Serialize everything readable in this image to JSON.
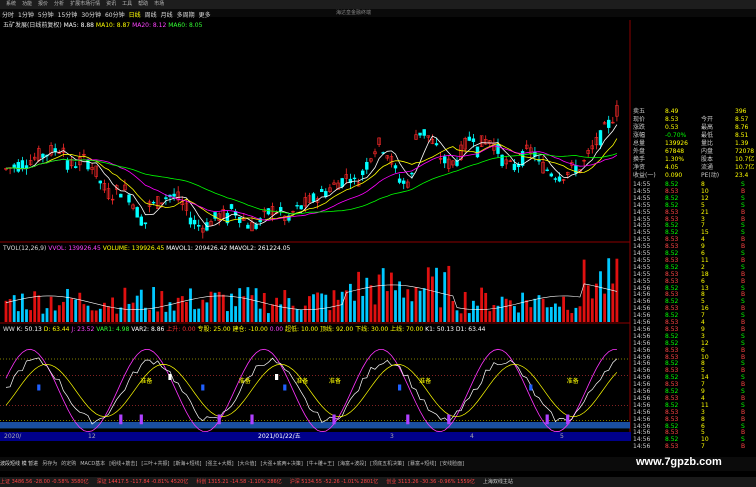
{
  "menu": [
    "系统",
    "功能",
    "报价",
    "分析",
    "扩展市场行情",
    "资讯",
    "工具",
    "帮助",
    "市场"
  ],
  "window_title": "海达皇金融终端",
  "periods": [
    "分时",
    "1分钟",
    "5分钟",
    "15分钟",
    "30分钟",
    "60分钟",
    "日线",
    "周线",
    "月线",
    "多周期",
    "更多"
  ],
  "stock_name": "五矿发展(日线前复权)",
  "ma": {
    "ma5": "MA5: 8.88",
    "ma10": "MA10: 8.87",
    "ma20": "MA20: 8.12",
    "ma60": "MA60: 8.05"
  },
  "vol": {
    "name": "TVOL(12,26,9)",
    "vvol": "VVOL: 139926.45",
    "volume": "VOLUME: 139926.45",
    "mavol1": "MAVOL1: 209426.42",
    "mavol2": "MAVOL2: 261224.05"
  },
  "ww": {
    "name": "WW",
    "k": "K: 50.13",
    "d": "D: 63.44",
    "j": "J: 23.52",
    "var1": "VAR1: 4.98",
    "var2": "VAR2: 8.86",
    "extra1": "上升: 0.00",
    "extra2": "专股: 25.00",
    "extra3": "建仓: -10.00",
    "extra4": "0.00",
    "extra5": "超低: 10.00",
    "extra6": "顶线: 92.00",
    "extra7": "下线: 30.00",
    "extra8": "上线: 70.00",
    "k1": "K1: 50.13",
    "d1": "D1: 63.44"
  },
  "labels": {
    "zhunbei": "准备",
    "cross": "十",
    "top": "顶"
  },
  "price_axis": [
    "8.50",
    "8.00",
    "7.50",
    "7.00",
    "6.50"
  ],
  "vol_axis": [
    "46562",
    "30000",
    "20000",
    "10000",
    "X10"
  ],
  "ww_axis": [
    "120.00",
    "100.00",
    "80.00",
    "60.00",
    "40.00",
    "20.00",
    "0.00"
  ],
  "dates": [
    "2020/",
    "12",
    "2021/01/22/五",
    "3",
    "4",
    "5"
  ],
  "quote": {
    "rows": [
      {
        "l": "卖五",
        "v": "8.49",
        "r": "",
        "rv": "396"
      },
      {
        "l": "现价",
        "v": "8.53",
        "r": "今开",
        "rv": "8.57"
      },
      {
        "l": "涨跌",
        "v": "0.53",
        "r": "最高",
        "rv": "8.76"
      },
      {
        "l": "涨幅",
        "v": "-0.70%",
        "r": "最低",
        "rv": "8.51"
      },
      {
        "l": "总量",
        "v": "139926",
        "r": "量比",
        "rv": "1.39"
      },
      {
        "l": "外盘",
        "v": "67848",
        "r": "内盘",
        "rv": "72078"
      },
      {
        "l": "换手",
        "v": "1.30%",
        "r": "股本",
        "rv": "10.7亿"
      },
      {
        "l": "净资",
        "v": "4.05",
        "r": "流通",
        "rv": "10.7亿"
      },
      {
        "l": "收益(一)",
        "v": "0.090",
        "r": "PE(动)",
        "rv": "23.4"
      }
    ],
    "ticks": [
      {
        "t": "14:55",
        "p": "8.52",
        "v": "8",
        "d": "S"
      },
      {
        "t": "14:55",
        "p": "8.53",
        "v": "10",
        "d": "B"
      },
      {
        "t": "14:55",
        "p": "8.52",
        "v": "12",
        "d": "S"
      },
      {
        "t": "14:55",
        "p": "8.52",
        "v": "5",
        "d": "S"
      },
      {
        "t": "14:55",
        "p": "8.53",
        "v": "21",
        "d": "B"
      },
      {
        "t": "14:55",
        "p": "8.53",
        "v": "3",
        "d": "B"
      },
      {
        "t": "14:55",
        "p": "8.52",
        "v": "7",
        "d": "S"
      },
      {
        "t": "14:55",
        "p": "8.52",
        "v": "15",
        "d": "S"
      },
      {
        "t": "14:55",
        "p": "8.53",
        "v": "4",
        "d": "B"
      },
      {
        "t": "14:55",
        "p": "8.53",
        "v": "9",
        "d": "B"
      },
      {
        "t": "14:55",
        "p": "8.52",
        "v": "6",
        "d": "S"
      },
      {
        "t": "14:55",
        "p": "8.53",
        "v": "11",
        "d": "B"
      },
      {
        "t": "14:55",
        "p": "8.52",
        "v": "2",
        "d": "S"
      },
      {
        "t": "14:55",
        "p": "8.53",
        "v": "18",
        "d": "B"
      },
      {
        "t": "14:55",
        "p": "8.53",
        "v": "6",
        "d": "B"
      },
      {
        "t": "14:56",
        "p": "8.52",
        "v": "13",
        "d": "S"
      },
      {
        "t": "14:56",
        "p": "8.53",
        "v": "8",
        "d": "B"
      },
      {
        "t": "14:56",
        "p": "8.52",
        "v": "5",
        "d": "S"
      },
      {
        "t": "14:56",
        "p": "8.53",
        "v": "16",
        "d": "B"
      },
      {
        "t": "14:56",
        "p": "8.52",
        "v": "7",
        "d": "S"
      },
      {
        "t": "14:56",
        "p": "8.53",
        "v": "4",
        "d": "B"
      },
      {
        "t": "14:56",
        "p": "8.53",
        "v": "9",
        "d": "B"
      },
      {
        "t": "14:56",
        "p": "8.52",
        "v": "3",
        "d": "S"
      },
      {
        "t": "14:56",
        "p": "8.52",
        "v": "12",
        "d": "S"
      },
      {
        "t": "14:56",
        "p": "8.53",
        "v": "6",
        "d": "B"
      },
      {
        "t": "14:56",
        "p": "8.53",
        "v": "10",
        "d": "B"
      },
      {
        "t": "14:56",
        "p": "8.52",
        "v": "8",
        "d": "S"
      },
      {
        "t": "14:56",
        "p": "8.53",
        "v": "5",
        "d": "B"
      },
      {
        "t": "14:56",
        "p": "8.52",
        "v": "14",
        "d": "S"
      },
      {
        "t": "14:56",
        "p": "8.53",
        "v": "7",
        "d": "B"
      },
      {
        "t": "14:56",
        "p": "8.52",
        "v": "9",
        "d": "S"
      },
      {
        "t": "14:56",
        "p": "8.53",
        "v": "4",
        "d": "B"
      },
      {
        "t": "14:56",
        "p": "8.52",
        "v": "11",
        "d": "S"
      },
      {
        "t": "14:56",
        "p": "8.53",
        "v": "3",
        "d": "B"
      },
      {
        "t": "14:56",
        "p": "8.53",
        "v": "8",
        "d": "B"
      },
      {
        "t": "14:56",
        "p": "8.52",
        "v": "6",
        "d": "S"
      },
      {
        "t": "14:56",
        "p": "8.53",
        "v": "5",
        "d": "B"
      },
      {
        "t": "14:56",
        "p": "8.52",
        "v": "10",
        "d": "S"
      },
      {
        "t": "14:56",
        "p": "8.53",
        "v": "7",
        "d": "B"
      }
    ]
  },
  "tabs": [
    "波段短线 模 暂进",
    "另存为",
    "的定购",
    "MACD基本",
    "[组线+筋击]",
    "[三叶+共振]",
    "[斯海+短线]",
    "[强主+大概]",
    "[大众值]",
    "[大强+底两+决策]",
    "[牛+雕+王]",
    "[海富+波段]",
    "[顶底五机决策]",
    "[暴富+短线]",
    "[安线脸面]"
  ],
  "status": [
    "上证 3486.56 -28.00 -0.58% 3580亿",
    "深证 14417.5 -117.84 -0.81% 4520亿",
    "科创 1315.21 -14.58 -1.10% 286亿",
    "沪深 5134.55 -52.26 -1.01% 2801亿",
    "创业 3113.26 -30.36 -0.96% 1559亿",
    "上海双线主站"
  ],
  "watermark": "www.7gpzb.com",
  "colors": {
    "up": "#ff2a2a",
    "down": "#00ffff",
    "ma5": "#ffffff",
    "ma10": "#ffff00",
    "ma20": "#ff00ff",
    "ma60": "#00ff00",
    "magenta": "#ff33ff",
    "blue": "#1e90ff"
  }
}
